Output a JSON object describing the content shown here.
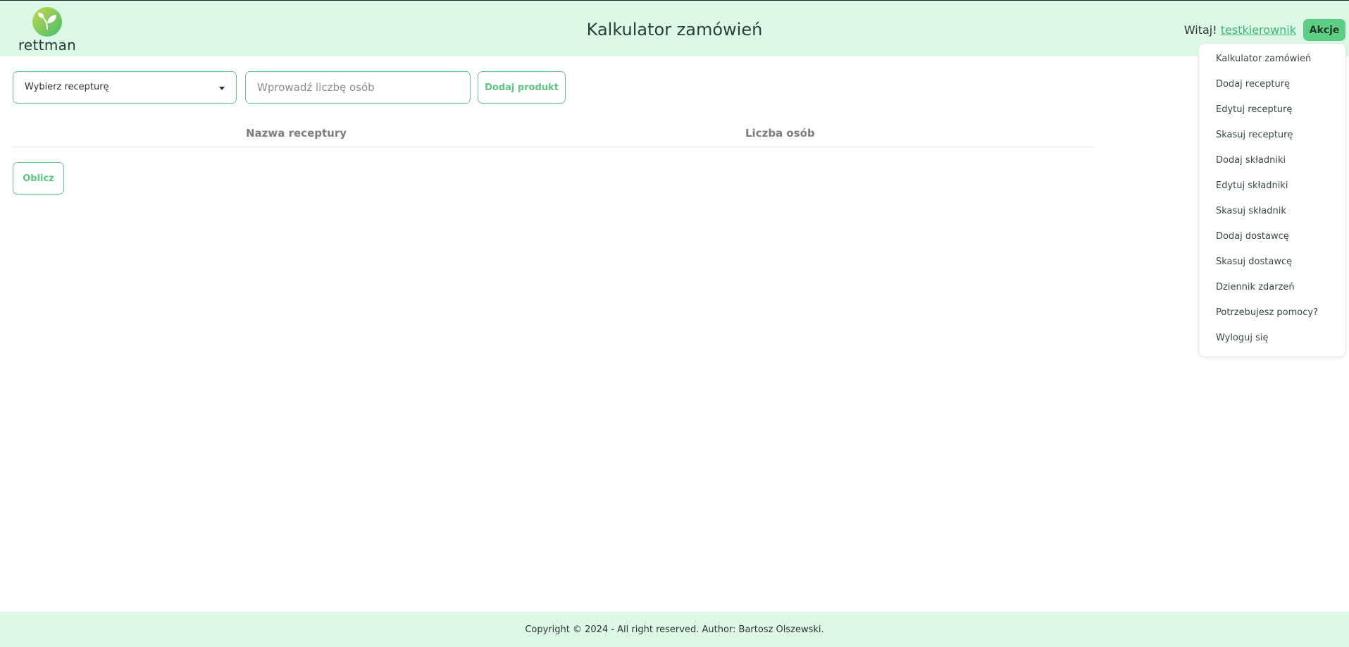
{
  "brand": {
    "name": "rettman",
    "colors": {
      "header_bg": "#dcf8e7",
      "accent": "#5ccf85",
      "link": "#3cb46e"
    }
  },
  "header": {
    "title": "Kalkulator zamówień",
    "welcome_prefix": "Witaj!",
    "username": "testkierownik",
    "actions_label": "Akcje"
  },
  "menu": {
    "items": [
      "Kalkulator zamówień",
      "Dodaj recepturę",
      "Edytuj recepturę",
      "Skasuj recepturę",
      "Dodaj składniki",
      "Edytuj składniki",
      "Skasuj składnik",
      "Dodaj dostawcę",
      "Skasuj dostawcę",
      "Dziennik zdarzeń",
      "Potrzebujesz pomocy?",
      "Wyloguj się"
    ]
  },
  "form": {
    "recipe_select_label": "Wybierz recepturę",
    "people_placeholder": "Wprowadź liczbę osób",
    "people_value": "",
    "add_button": "Dodaj produkt",
    "calc_button": "Oblicz"
  },
  "table": {
    "columns": [
      "Nazwa receptury",
      "Liczba osób"
    ],
    "rows": []
  },
  "footer": {
    "copyright": "Copyright © 2024 - All right reserved. Author: Bartosz Olszewski."
  }
}
